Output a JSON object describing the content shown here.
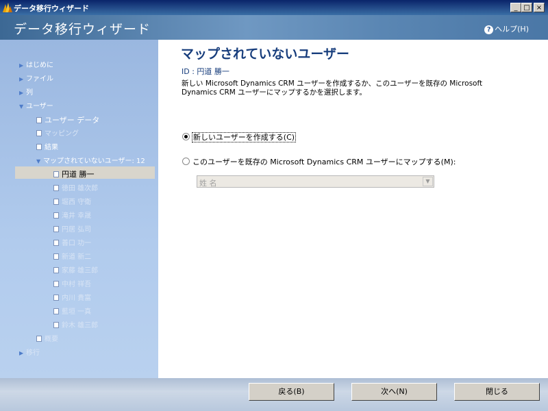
{
  "window": {
    "title": "データ移行ウィザード",
    "controls": {
      "minimize": "_",
      "maximize": "□",
      "close": "×"
    }
  },
  "banner": {
    "title": "データ移行ウィザード",
    "help_label": "ヘルプ(H)",
    "help_icon": "?"
  },
  "sidebar": {
    "items": [
      {
        "label": "はじめに"
      },
      {
        "label": "ファイル"
      },
      {
        "label": "列"
      },
      {
        "label": "ユーザー"
      },
      {
        "label": "ユーザー データ"
      },
      {
        "label": "マッピング"
      },
      {
        "label": "結果"
      },
      {
        "label": "マップされていないユーザー: 12"
      },
      {
        "label": "円道 勝一"
      },
      {
        "label": "徳田 雄次郎"
      },
      {
        "label": "堀西 守衛"
      },
      {
        "label": "滝井 幸晟"
      },
      {
        "label": "円居 弘司"
      },
      {
        "label": "善口 功一"
      },
      {
        "label": "新道 新二"
      },
      {
        "label": "家藤 雄三郎"
      },
      {
        "label": "中村 祥吾"
      },
      {
        "label": "内川 貴富"
      },
      {
        "label": "藍垣 一真"
      },
      {
        "label": "鈴木 雄三郎"
      },
      {
        "label": "概要"
      },
      {
        "label": "移行"
      }
    ]
  },
  "main": {
    "heading": "マップされていないユーザー",
    "id_line": "ID : 円道 勝一",
    "description": "新しい Microsoft Dynamics CRM ユーザーを作成するか、このユーザーを既存の Microsoft Dynamics CRM ユーザーにマップするかを選択します。",
    "option_new": "新しいユーザーを作成する(C)",
    "option_map": "このユーザーを既存の Microsoft Dynamics CRM ユーザーにマップする(M):",
    "selected_option": "new",
    "combo_value": "姓 名",
    "combo_arrow": "▼"
  },
  "footer": {
    "back": "戻る(B)",
    "next": "次へ(N)",
    "close": "閉じる"
  }
}
